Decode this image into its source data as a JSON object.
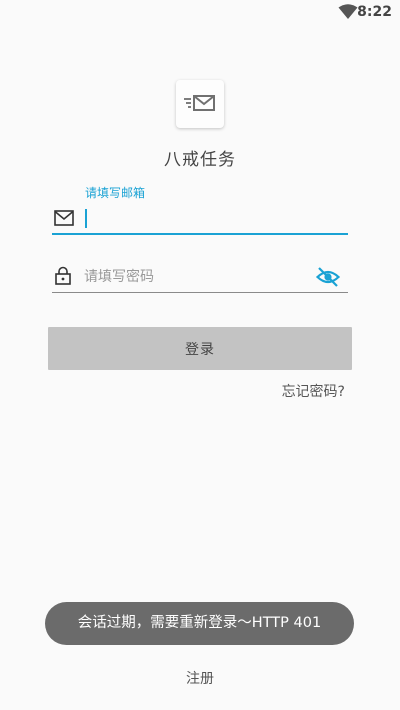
{
  "status_bar": {
    "time": "8:22",
    "wifi_icon": "wifi-icon"
  },
  "app": {
    "name": "八戒任务",
    "logo_icon": "mail-send-icon"
  },
  "email": {
    "label": "请填写邮箱",
    "value": "",
    "icon": "mail-icon",
    "accent_color": "#1aa2d4"
  },
  "password": {
    "placeholder": "请填写密码",
    "value": "",
    "icon": "lock-icon",
    "toggle_icon": "eye-off-icon"
  },
  "login_button": {
    "label": "登录"
  },
  "forgot_password": {
    "label": "忘记密码?"
  },
  "toast": {
    "message": "会话过期，需要重新登录～HTTP 401"
  },
  "register": {
    "label": "注册"
  }
}
